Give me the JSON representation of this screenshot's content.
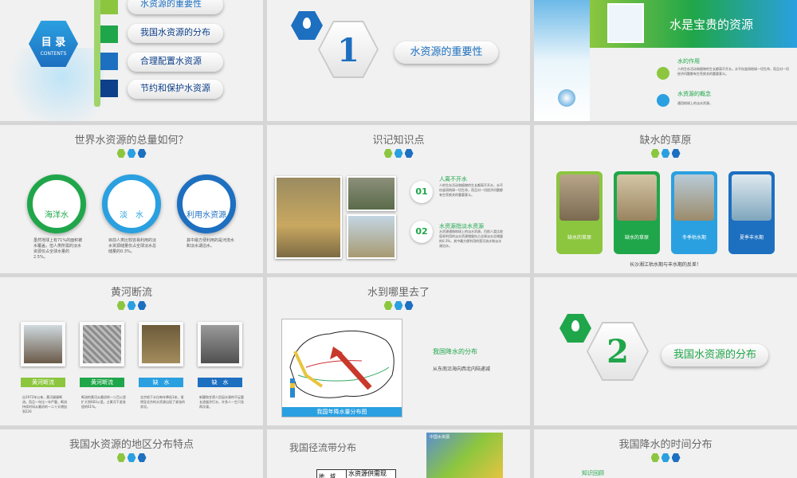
{
  "colors": {
    "green": "#20a64a",
    "lightgreen": "#8cc63f",
    "blue": "#2aa0e0",
    "darkblue": "#0d3f8a",
    "accent": "#1b6fbf"
  },
  "toc": {
    "title": "目 录",
    "subtitle": "CONTENTS",
    "items": [
      "水资源的重要性",
      "我国水资源的分布",
      "合理配置水资源",
      "节约和保护水资源"
    ]
  },
  "section1": {
    "number": "1",
    "title": "水资源的重要性"
  },
  "precious": {
    "title": "水是宝贵的资源",
    "item1_title": "水的作用",
    "item1_text": "人的生存活动和植物的生长都离不开水。水不仅滋润地球一切生命，而且对一切经济问题都有生死攸关的重要意义。",
    "item2_title": "水资源的概念",
    "item2_text": "通用地球上的淡水资源。"
  },
  "world": {
    "title": "世界水资源的总量如何？",
    "circles": [
      "海洋水",
      "淡　水",
      "利用水资源"
    ],
    "texts": [
      "虽然地球上有71%的面积被水覆盖，但人类所需的淡水资源仅占全球水量的2.5%。",
      "目前人类比较容易利用的淡水资源储量仅占全球淡水总储量的0.3%。",
      "其中最方便利用的是河流水和淡水湖泊水。"
    ]
  },
  "knowledge": {
    "title": "识记知识点",
    "points": [
      {
        "num": "01",
        "title": "人离不开水",
        "text": "人的生存活动和植物的生长都离不开水，水不仅滋润地球一切生命，而且对一切经济问题都有生死攸关的重要意义。"
      },
      {
        "num": "02",
        "title": "水资源指淡水资源",
        "text": "水资源通指地球上的淡水资源。目前人类比较容易利用的淡水资源储量仅占全球淡水总储量的0.3%，其中最方便利用的是河流水和淡水湖泊水。"
      }
    ]
  },
  "grassland": {
    "title": "缺水的草原",
    "cards": [
      "缺水的草原",
      "缺水的草原",
      "冬季枯水期",
      "夏季丰水期"
    ],
    "caption": "长沙湘江枯水期与丰水期的反差！"
  },
  "yellowriver": {
    "title": "黄河断流",
    "labels": [
      "黄河断流",
      "黄河断流",
      "缺　水",
      "缺　水"
    ],
    "texts": [
      "自1972年以来，黄河屡屡断流。而且一年比一年严重，断流持续时间从最初的一二十天增加到226",
      "断流的黄河从最初的一二百公里扩大到683公里。占黄河下游流程的61%。",
      "北京地下水位每年降低3米，很明显北京的水资源出现了紧张的状况。",
      "新疆和甘肃人民因水源的不足要长途跋涉打水，许多人一生只洗两次澡。"
    ]
  },
  "wherewater": {
    "title": "水到哪里去了",
    "map_caption": "我国年降水量分布图",
    "subtitle": "我国降水的分布",
    "text": "从东南沿海向西北内陆递减"
  },
  "section2": {
    "number": "2",
    "title": "我国水资源的分布"
  },
  "regional": {
    "title": "我国水资源的地区分布特点"
  },
  "runoff": {
    "title": "我国径流带分布",
    "table_col1": "地　域",
    "table_col2": "水资源供需现",
    "map_title": "中国水资源"
  },
  "timeline": {
    "title": "我国降水的时间分布",
    "label": "知识回顾"
  }
}
